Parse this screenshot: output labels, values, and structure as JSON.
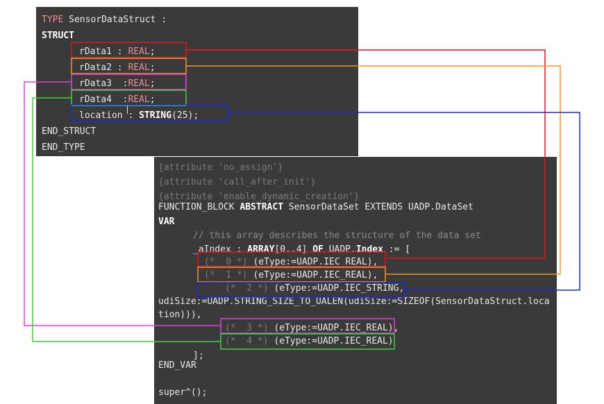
{
  "struct": {
    "line1_kw": "TYPE",
    "line1_name": " SensorDataStruct :",
    "line2": "STRUCT",
    "fields": [
      {
        "name": "rData1 : ",
        "type": "REAL",
        "end": ";"
      },
      {
        "name": "rData2 : ",
        "type": "REAL",
        "end": ";"
      },
      {
        "name": "rData3  :",
        "type": "REAL",
        "end": ";"
      },
      {
        "name": "rData4  :",
        "type": "REAL",
        "end": ";"
      }
    ],
    "location_name": "location : ",
    "location_type": "STRING",
    "location_end": "(25);",
    "end_struct": "END_STRUCT",
    "end_type": "END_TYPE"
  },
  "fb": {
    "attrs": [
      "{attribute 'no_assign'}",
      "{attribute 'call_after_init'}",
      "{attribute 'enable_dynamic_creation'}"
    ],
    "decl_pre": "FUNCTION_BLOCK ",
    "decl_kw": "ABSTRACT",
    "decl_post": " SensorDataSet EXTENDS UADP.DataSet",
    "var": "VAR",
    "comment": "// this array describes the structure of the data set",
    "aindex_pre": "_aIndex : ",
    "aindex_kw1": "ARRAY",
    "aindex_mid": "[0..4] ",
    "aindex_kw2": "OF",
    "aindex_mid2": " UADP.",
    "aindex_kw3": "Index",
    "aindex_post": " := [",
    "entries": [
      {
        "idx": "(*  0 *)",
        "val": " (eType:=UADP.IEC_REAL),"
      },
      {
        "idx": "(*  1 *)",
        "val": " (eType:=UADP.IEC_REAL),"
      },
      {
        "idx": "(*  2 *)",
        "val": " (eType:=UADP.IEC_STRING,"
      },
      {
        "idx": "(*  3 *)",
        "val": " (eType:=UADP.IEC_REAL),"
      },
      {
        "idx": "(*  4 *)",
        "val": " (eType:=UADP.IEC_REAL)"
      }
    ],
    "udisize_1": "udiSize:=UADP.STRING_SIZE_TO_UALEN(udiSize:=SIZEOF(SensorDataStruct.loca",
    "udisize_2": "tion))),",
    "close": "];",
    "end_var": "END_VAR",
    "super_call": "super^();"
  },
  "colors": {
    "red": "#e8141e",
    "orange": "#f0962a",
    "magenta": "#e040d8",
    "green": "#3cd23c",
    "blue": "#1a2ad6"
  }
}
